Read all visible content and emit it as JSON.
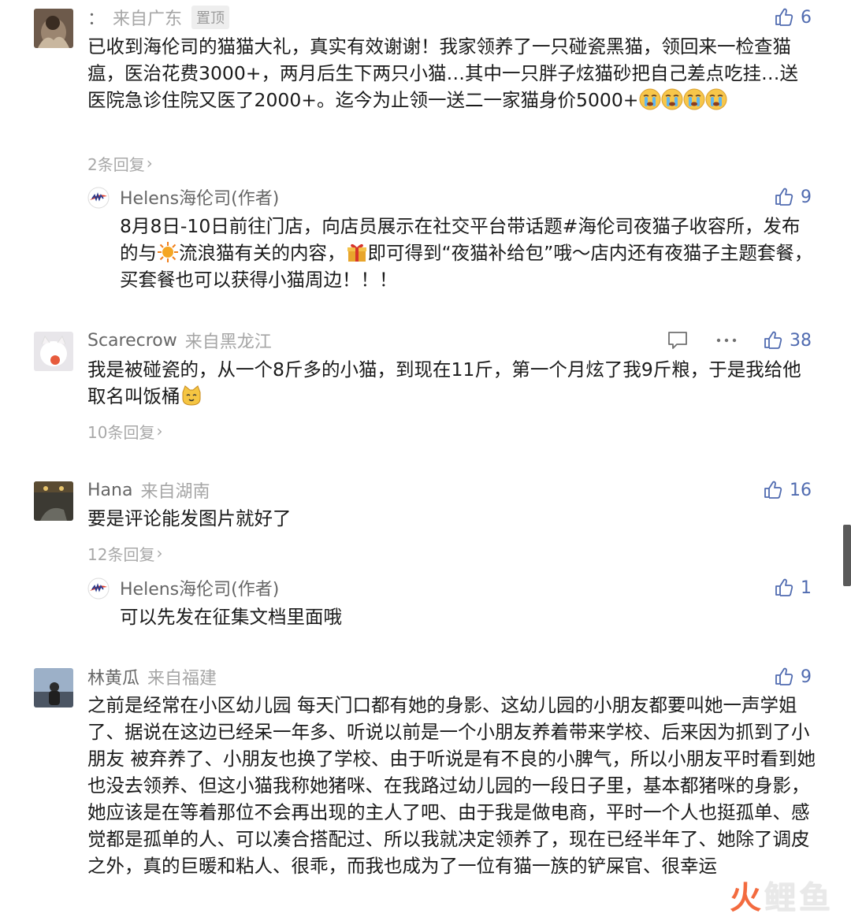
{
  "comments": [
    {
      "username": "：",
      "location": "来自广东",
      "pin_label": "置顶",
      "likes": "6",
      "text": "已收到海伦司的猫猫大礼，真实有效谢谢！我家领养了一只碰瓷黑猫，领回来一检查猫瘟，医治花费3000+，两月后生下两只小猫…其中一只胖子炫猫砂把自己差点吃挂…送医院急诊住院又医了2000+。迄今为止领一送二一家猫身价5000+",
      "replies_label": "2条回复",
      "reply": {
        "username": "Helens海伦司(作者)",
        "likes": "9",
        "text_1": "8月8日-10日前往门店，向店员展示在社交平台带话题#海伦司夜猫子收容所，发布的与",
        "text_2": "流浪猫有关的内容，",
        "text_3": "即可得到“夜猫补给包”哦～店内还有夜猫子主题套餐，买套餐也可以获得小猫周边！！！"
      }
    },
    {
      "username": "Scarecrow",
      "location": "来自黑龙江",
      "likes": "38",
      "text": "我是被碰瓷的，从一个8斤多的小猫，到现在11斤，第一个月炫了我9斤粮，于是我给他取名叫饭桶",
      "replies_label": "10条回复"
    },
    {
      "username": "Hana",
      "location": "来自湖南",
      "likes": "16",
      "text": "要是评论能发图片就好了",
      "replies_label": "12条回复",
      "reply": {
        "username": "Helens海伦司(作者)",
        "likes": "1",
        "text": "可以先发在征集文档里面哦"
      }
    },
    {
      "username": "林黄瓜",
      "location": "来自福建",
      "likes": "9",
      "text": "之前是经常在小区幼儿园 每天门口都有她的身影、这幼儿园的小朋友都要叫她一声学姐了、据说在这边已经呆一年多、听说以前是一个小朋友养着带来学校、后来因为抓到了小朋友 被弃养了、小朋友也换了学校、由于听说是有不良的小脾气，所以小朋友平时看到她也没去领养、但这小猫我称她猪咪、在我路过幼儿园的一段日子里，基本都猪咪的身影，她应该是在等着那位不会再出现的主人了吧、由于我是做电商，平时一个人也挺孤单、感觉都是孤单的人、可以凑合搭配过、所以我就决定领养了，现在已经半年了、她除了调皮之外，真的巨暖和粘人、很乖，而我也成为了一位有猫一族的铲屎官、很幸运"
    }
  ],
  "watermark": {
    "part1": "火",
    "part2": "鲤鱼"
  },
  "colors": {
    "accent": "#506bb0",
    "muted": "#a8a8a8",
    "brand": "#e3412b"
  },
  "icons": [
    "thumbs-up-icon",
    "comment-icon",
    "more-icon",
    "chevron-right-icon",
    "crying-emoji",
    "sun-emoji",
    "gift-emoji",
    "cat-emoji"
  ]
}
